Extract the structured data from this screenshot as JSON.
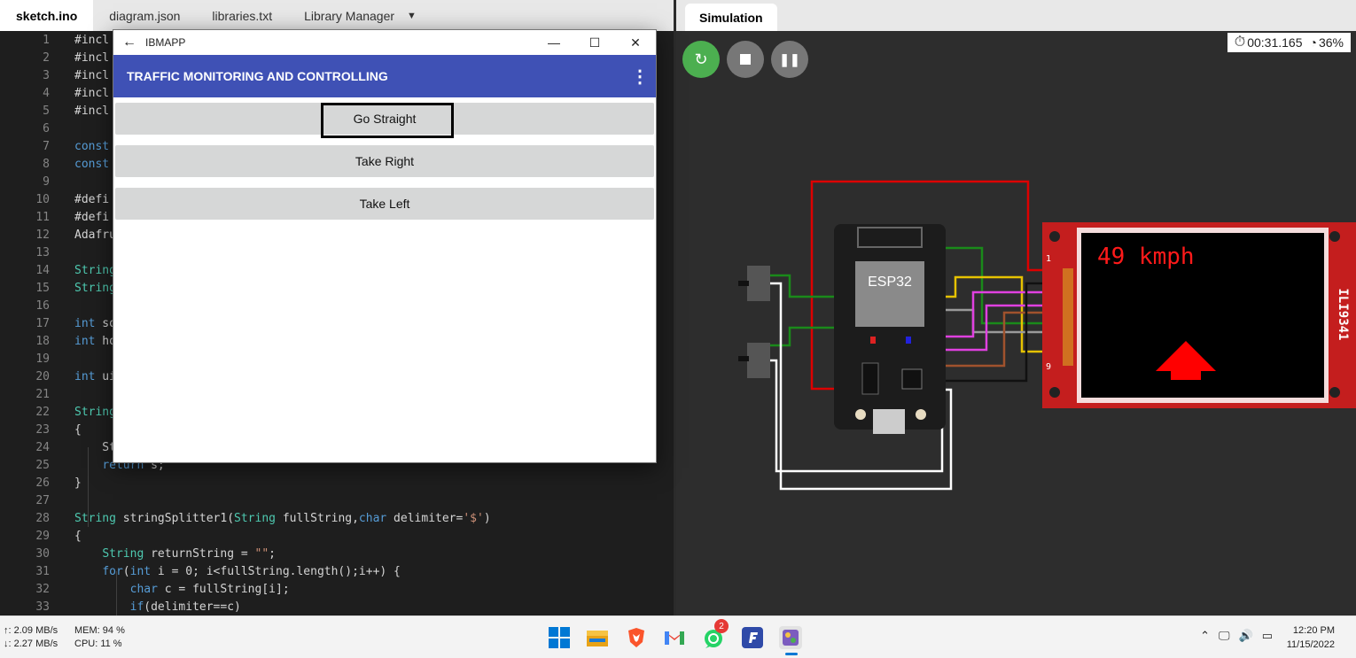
{
  "editor": {
    "tabs": [
      "sketch.ino",
      "diagram.json",
      "libraries.txt",
      "Library Manager"
    ],
    "lines": [
      {
        "n": "1",
        "t": "#incl"
      },
      {
        "n": "2",
        "t": "#incl"
      },
      {
        "n": "3",
        "t": "#incl"
      },
      {
        "n": "4",
        "t": "#incl"
      },
      {
        "n": "5",
        "t": "#incl"
      },
      {
        "n": "6",
        "t": ""
      },
      {
        "n": "7",
        "t": "const"
      },
      {
        "n": "8",
        "t": "const"
      },
      {
        "n": "9",
        "t": ""
      },
      {
        "n": "10",
        "t": "#defi"
      },
      {
        "n": "11",
        "t": "#defi"
      },
      {
        "n": "12",
        "t": "Adafru"
      },
      {
        "n": "13",
        "t": ""
      },
      {
        "n": "14",
        "t": "String"
      },
      {
        "n": "15",
        "t": "String"
      },
      {
        "n": "16",
        "t": ""
      },
      {
        "n": "17",
        "t": "int so"
      },
      {
        "n": "18",
        "t": "int ho"
      },
      {
        "n": "19",
        "t": ""
      },
      {
        "n": "20",
        "t": "int ui"
      },
      {
        "n": "21",
        "t": ""
      },
      {
        "n": "22",
        "t": "String"
      },
      {
        "n": "23",
        "t": "{"
      },
      {
        "n": "24",
        "t": "    St"
      },
      {
        "n": "25",
        "t": "    return s;"
      },
      {
        "n": "26",
        "t": "}"
      },
      {
        "n": "27",
        "t": ""
      },
      {
        "n": "28",
        "t": "String stringSplitter1(String fullString,char delimiter='$')"
      },
      {
        "n": "29",
        "t": "{"
      },
      {
        "n": "30",
        "t": "    String returnString = \"\";"
      },
      {
        "n": "31",
        "t": "    for(int i = 0; i<fullString.length();i++) {"
      },
      {
        "n": "32",
        "t": "        char c = fullString[i];"
      },
      {
        "n": "33",
        "t": "        if(delimiter==c)"
      }
    ]
  },
  "app": {
    "window_title": "IBMAPP",
    "bar_title": "TRAFFIC MONITORING AND CONTROLLING",
    "buttons": [
      "Go Straight",
      "Take Right",
      "Take Left"
    ]
  },
  "sim": {
    "tab": "Simulation",
    "time": "00:31.165",
    "speed": "36%",
    "chip": "ESP32",
    "display_text": "49 kmph",
    "display_model": "ILI9341",
    "pin1": "1",
    "pin9": "9"
  },
  "taskbar": {
    "up": "↑: 2.09 MB/s",
    "down": "↓: 2.27 MB/s",
    "mem": "MEM: 94 %",
    "cpu": "CPU: 11 %",
    "time": "12:20 PM",
    "date": "11/15/2022",
    "whatsapp_badge": "2"
  }
}
